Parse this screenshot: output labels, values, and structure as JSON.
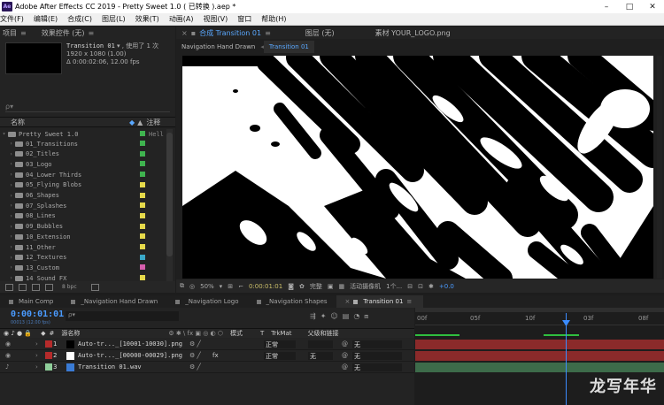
{
  "app": {
    "title": "Adobe After Effects CC 2019 - Pretty Sweet 1.0 ( 已转换 ).aep *",
    "logo": "Ae",
    "win_min": "–",
    "win_max": "□",
    "win_close": "✕"
  },
  "menu": [
    "文件(F)",
    "编辑(E)",
    "合成(C)",
    "图层(L)",
    "效果(T)",
    "动画(A)",
    "视图(V)",
    "窗口",
    "帮助(H)"
  ],
  "project_panel": {
    "tab": "项目",
    "effects_tab": "效果控件 (无)",
    "comp_name": "Transition 01",
    "used": "▾ , 使用了 1 次",
    "size": "1920 x 1080 (1.00)",
    "duration": "Δ 0:00:02:06, 12.00 fps",
    "search_placeholder": "ρ▾",
    "col_name": "名称",
    "col_note": "注释",
    "root": "Pretty Sweet 1.0",
    "root_note": "Hell",
    "items": [
      {
        "name": "01_Transitions",
        "color": "#3fb34f"
      },
      {
        "name": "02_Titles",
        "color": "#3fb34f"
      },
      {
        "name": "03_Logo",
        "color": "#3fb34f"
      },
      {
        "name": "04_Lower Thirds",
        "color": "#3fb34f"
      },
      {
        "name": "05_Flying Blobs",
        "color": "#e5d94a"
      },
      {
        "name": "06_Shapes",
        "color": "#e5d94a"
      },
      {
        "name": "07_Splashes",
        "color": "#e5d94a"
      },
      {
        "name": "08_Lines",
        "color": "#e5d94a"
      },
      {
        "name": "09_Bubbles",
        "color": "#e5d94a"
      },
      {
        "name": "10_Extension",
        "color": "#e5d94a"
      },
      {
        "name": "11_Other",
        "color": "#e5d94a"
      },
      {
        "name": "12_Textures",
        "color": "#3aa8c8"
      },
      {
        "name": "13_Custom",
        "color": "#d75fae"
      },
      {
        "name": "14_Sound FX",
        "color": "#e5d94a"
      }
    ],
    "footer_bpc": "8 bpc"
  },
  "viewer": {
    "comp_tab": "合成 Transition 01",
    "layer_tab": "图层 (无)",
    "footage_tab": "素材 YOUR_LOGO.png",
    "crumbs": [
      "Navigation Hand Drawn",
      "Transition 01"
    ],
    "zoom": "50%",
    "timecode": "0:00:01:01",
    "quality": "完整",
    "camera": "活动摄像机",
    "views": "1个...",
    "exposure": "+0.0"
  },
  "timeline": {
    "tabs": [
      "Main Comp",
      "_Navigation Hand Drawn",
      "_Navigation Logo",
      "_Navigation Shapes",
      "Transition 01"
    ],
    "active_tab": "Transition 01",
    "timecode": "0:00:01:01",
    "frames_info": "00013 (12.00 fps)",
    "search_placeholder": "ρ▾",
    "col_source": "源名称",
    "col_mode": "模式",
    "col_t": "T",
    "col_trkmat": "TrkMat",
    "col_parent": "父级和链接",
    "layers": [
      {
        "num": "1",
        "name": "Auto-tr..._[10001-10030].png",
        "mode": "正常",
        "trk": "",
        "parent": "无",
        "color": "#b52b2b",
        "swatch": "#000000"
      },
      {
        "num": "2",
        "name": "Auto-tr..._[00000-00029].png",
        "mode": "正常",
        "trk": "无",
        "parent": "无",
        "color": "#b52b2b",
        "swatch": "#ffffff"
      },
      {
        "num": "3",
        "name": "Transition 01.wav",
        "mode": "",
        "trk": "",
        "parent": "无",
        "color": "#8fcf9a",
        "swatch": "#3a7bd5"
      }
    ],
    "ruler": [
      "00f",
      "05f",
      "10f",
      "03f",
      "08f"
    ]
  },
  "watermark": "龙写年华"
}
